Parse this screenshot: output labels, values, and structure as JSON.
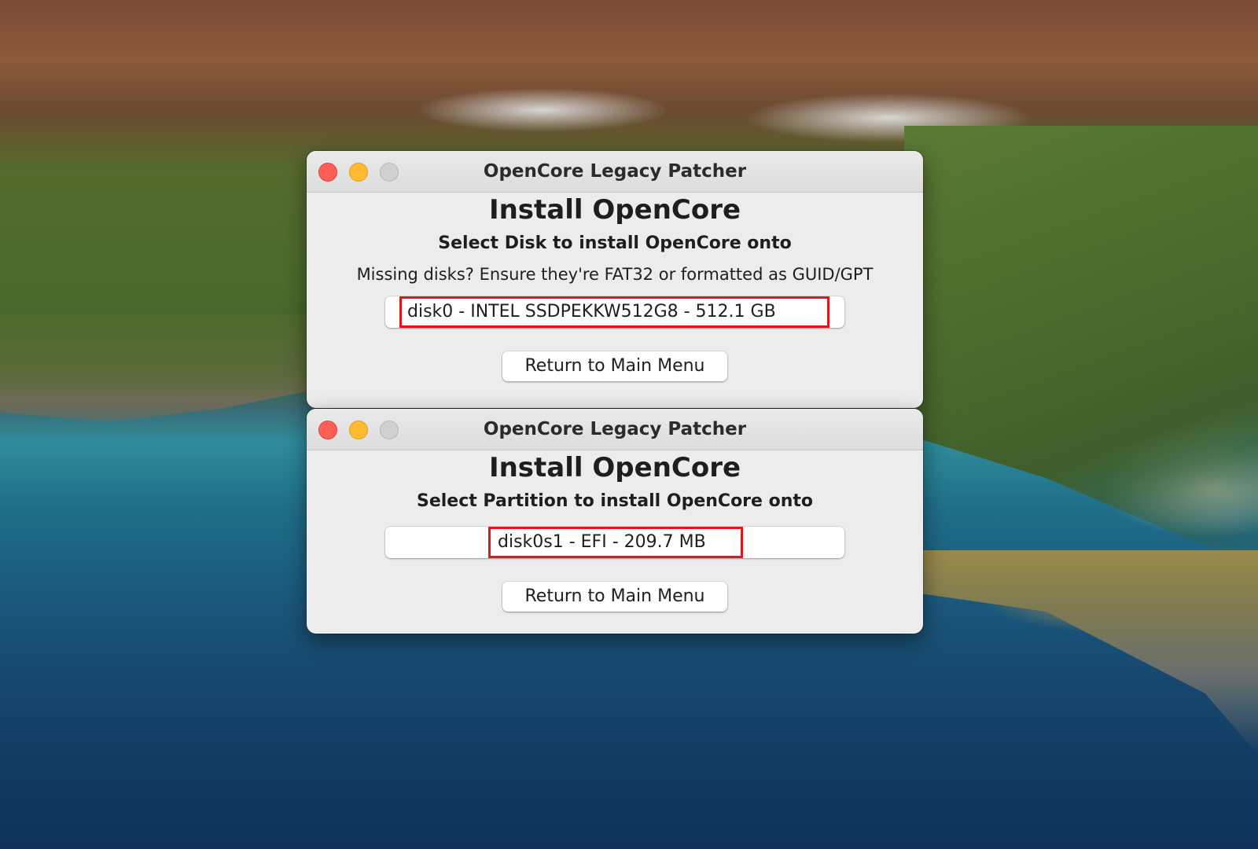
{
  "wallpaper": {
    "name": "macOS Big Sur coastline"
  },
  "colors": {
    "window_bg": "#ececec",
    "close": "#fe5f57",
    "minimize": "#febc2e",
    "zoom_inactive": "#d0d0d0",
    "highlight": "#e0161e"
  },
  "windows": [
    {
      "title": "OpenCore Legacy Patcher",
      "heading": "Install OpenCore",
      "subheading": "Select Disk to install OpenCore onto",
      "note": "Missing disks? Ensure they're FAT32 or formatted as GUID/GPT",
      "selection": "disk0 - INTEL SSDPEKKW512G8 - 512.1 GB",
      "button_label": "Return to Main Menu"
    },
    {
      "title": "OpenCore Legacy Patcher",
      "heading": "Install OpenCore",
      "subheading": "Select Partition to install OpenCore onto",
      "selection": "disk0s1 - EFI - 209.7 MB",
      "button_label": "Return to Main Menu"
    }
  ]
}
